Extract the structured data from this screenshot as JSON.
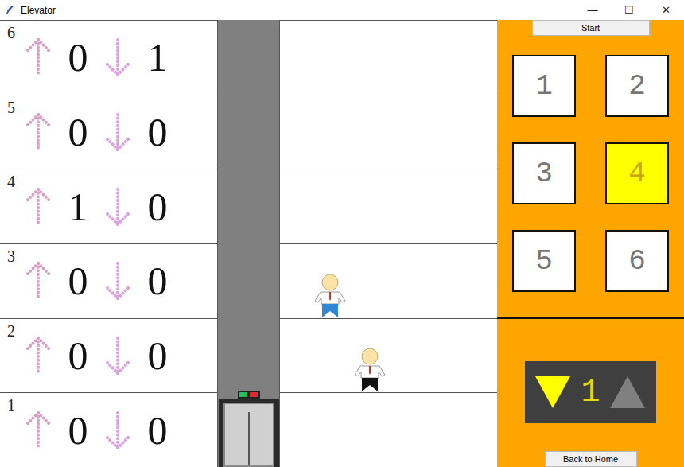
{
  "window": {
    "title": "Elevator",
    "controls": [
      "—",
      "☐",
      "✕"
    ]
  },
  "floors": [
    {
      "number": "6",
      "up": "0",
      "down": "1"
    },
    {
      "number": "5",
      "up": "0",
      "down": "0"
    },
    {
      "number": "4",
      "up": "1",
      "down": "0"
    },
    {
      "number": "3",
      "up": "0",
      "down": "0"
    },
    {
      "number": "2",
      "up": "0",
      "down": "0"
    },
    {
      "number": "1",
      "up": "0",
      "down": "0"
    }
  ],
  "elevator": {
    "floor": "1",
    "lights": [
      {
        "on": true,
        "color": "#1fbf5a"
      },
      {
        "on": true,
        "color": "#e0282e"
      }
    ]
  },
  "people": [
    {
      "floor": "3",
      "color": "#2f86d6"
    },
    {
      "floor": "2",
      "color": "#111111"
    }
  ],
  "panel": {
    "start_button": "Start",
    "buttons": [
      {
        "label": "1",
        "selected": false
      },
      {
        "label": "2",
        "selected": false
      },
      {
        "label": "3",
        "selected": false
      },
      {
        "label": "4",
        "selected": true
      },
      {
        "label": "5",
        "selected": false
      },
      {
        "label": "6",
        "selected": false
      }
    ],
    "display": {
      "floor": "1",
      "down_active": true,
      "up_active": false
    },
    "back_button": "Back to Home"
  }
}
